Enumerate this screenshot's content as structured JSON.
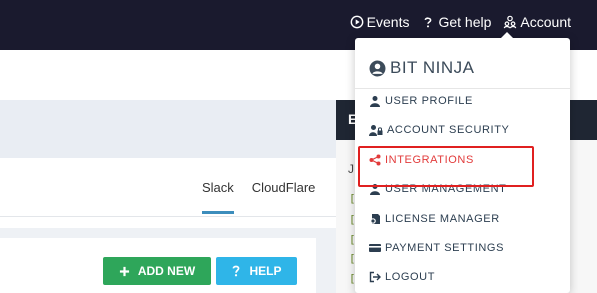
{
  "topnav": {
    "events": "Events",
    "help": "Get help",
    "account": "Account"
  },
  "right_panel": {
    "header_letter": "E",
    "j_text": "J",
    "green_marks": [
      "[",
      "[",
      "[",
      "[",
      "["
    ]
  },
  "tabs": [
    {
      "label": "Slack",
      "active": true
    },
    {
      "label": "CloudFlare",
      "active": false
    }
  ],
  "buttons": {
    "add_new": "ADD NEW",
    "help": "HELP"
  },
  "dropdown": {
    "title": "BIT NINJA",
    "items": [
      {
        "label": "USER PROFILE",
        "icon": "user-icon"
      },
      {
        "label": "ACCOUNT SECURITY",
        "icon": "user-lock-icon"
      },
      {
        "label": "INTEGRATIONS",
        "icon": "share-icon",
        "highlighted": true
      },
      {
        "label": "USER MANAGEMENT",
        "icon": "users-icon"
      },
      {
        "label": "LICENSE MANAGER",
        "icon": "license-icon"
      },
      {
        "label": "PAYMENT SETTINGS",
        "icon": "credit-card-icon"
      },
      {
        "label": "LOGOUT",
        "icon": "logout-icon"
      }
    ]
  },
  "colors": {
    "topbar": "#1a1a2e",
    "add_button": "#2ea65a",
    "help_button": "#2fb5e8",
    "highlight": "#e23b3b"
  }
}
